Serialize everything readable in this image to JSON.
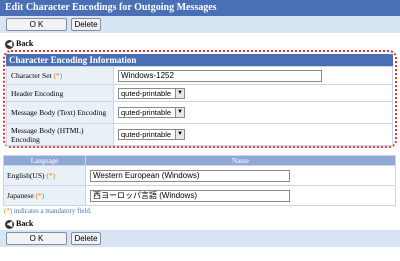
{
  "title": "Edit Character Encodings for Outgoing Messages",
  "buttons": {
    "ok": "O K",
    "delete": "Delete"
  },
  "back": {
    "label": "Back",
    "icon": "back-arrow-icon"
  },
  "section": {
    "title": "Character Encoding Information",
    "rows": [
      {
        "label": "Character Set",
        "required": "(*)",
        "value": "Windows-1252"
      },
      {
        "label": "Header Encoding",
        "value": "quted-printable"
      },
      {
        "label": "Message Body (Text) Encoding",
        "value": "quted-printable"
      },
      {
        "label": "Message Body (HTML) Encoding",
        "value": "quted-printable"
      }
    ]
  },
  "languages": {
    "headers": [
      "Language",
      "Name"
    ],
    "rows": [
      {
        "label": "English(US)",
        "required": "(*)",
        "value": "Western European (Windows)"
      },
      {
        "label": "Japanese",
        "required": "(*)",
        "value": "西ヨーロッパ言語 (Windows)"
      }
    ]
  },
  "note": {
    "marker": "(*)",
    "text": " indicates a mandatory field."
  },
  "colors": {
    "header_bg": "#4a6fb5",
    "button_bar_bg": "#d7e4f4",
    "required_marker": "#e07a00",
    "highlight_border": "#e0303a"
  }
}
